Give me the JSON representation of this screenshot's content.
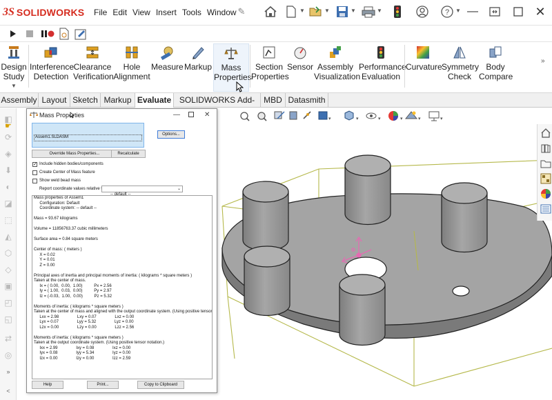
{
  "app": {
    "logo_ds": "3S",
    "logo_text": "SOLIDWORKS"
  },
  "menu": [
    "File",
    "Edit",
    "View",
    "Insert",
    "Tools",
    "Window"
  ],
  "ribbon": {
    "buttons": [
      {
        "label": "Design\nStudy",
        "icon": "design-study-icon"
      },
      {
        "label": "Interference\nDetection",
        "icon": "interference-icon"
      },
      {
        "label": "Clearance\nVerification",
        "icon": "clearance-icon"
      },
      {
        "label": "Hole\nAlignment",
        "icon": "hole-alignment-icon"
      },
      {
        "label": "Measure",
        "icon": "measure-icon"
      },
      {
        "label": "Markup",
        "icon": "markup-icon"
      },
      {
        "label": "Mass\nProperties",
        "icon": "mass-properties-icon"
      },
      {
        "label": "Section\nProperties",
        "icon": "section-properties-icon"
      },
      {
        "label": "Sensor",
        "icon": "sensor-icon"
      },
      {
        "label": "Assembly\nVisualization",
        "icon": "assembly-visualization-icon"
      },
      {
        "label": "Performance\nEvaluation",
        "icon": "performance-icon"
      },
      {
        "label": "Curvature",
        "icon": "curvature-icon"
      },
      {
        "label": "Symmetry\nCheck",
        "icon": "symmetry-icon"
      },
      {
        "label": "Body\nCompare",
        "icon": "body-compare-icon"
      }
    ]
  },
  "tabs": [
    "Assembly",
    "Layout",
    "Sketch",
    "Markup",
    "Evaluate",
    "SOLIDWORKS Add-Ins",
    "MBD",
    "Datasmith"
  ],
  "active_tab": "Evaluate",
  "dialog": {
    "title": "Mass Properties",
    "selection": "Assem1.SLDASM",
    "options_button": "Options...",
    "override_button": "Override Mass Properties...",
    "recalculate_button": "Recalculate",
    "check_hidden": "Include hidden bodies/components",
    "check_com": "Create Center of Mass feature",
    "check_weld": "Show weld bead mass",
    "report_label": "Report coordinate values relative to:",
    "report_value": "-- default --",
    "results": [
      "Mass properties of Assem1",
      "     Configuration: Default",
      "     Coordinate system: -- default --",
      "",
      "Mass = 93.67 kilograms",
      "",
      "Volume = 11856763.37 cubic millimeters",
      "",
      "Surface area = 0.84 square meters",
      "",
      "Center of mass: ( meters )",
      "     X = 0.02",
      "     Y = 0.01",
      "     Z = 0.00",
      "",
      "Principal axes of inertia and principal moments of inertia: ( kilograms * square meters )",
      "Taken at the center of mass.",
      "     Ix = ( 0.00,  0.00,  1.00)          Px = 2.56",
      "     Iy = ( 1.00,  0.03,  0.00)          Py = 2.97",
      "     Iz = (-0.03,  1.00,  0.00)          Pz = 5.32",
      "",
      "Moments of inertia: ( kilograms * square meters )",
      "Taken at the center of mass and aligned with the output coordinate system. (Using positive tensor",
      "     Lxx = 2.98                Lxy = 0.07                Lxz = 0.00",
      "     Lyx = 0.07                Lyy = 5.32                Lyz = 0.00",
      "     Lzx = 0.00                Lzy = 0.00                Lzz = 2.56",
      "",
      "Moments of inertia: ( kilograms * square meters )",
      "Taken at the output coordinate system. (Using positive tensor notation.)",
      "     Ixx = 2.99                Ixy = 0.08                Ixz = 0.00",
      "     Iyx = 0.08                Iyy = 5.34                Iyz = 0.00",
      "     Izx = 0.00                Izy = 0.00                Izz = 2.59"
    ],
    "help_button": "Help",
    "print_button": "Print...",
    "copy_button": "Copy to Clipboard"
  },
  "colors": {
    "brand_red": "#d52b1e",
    "part_gray": "#9a9a9a",
    "bbox_yellow": "#b5b84a"
  }
}
